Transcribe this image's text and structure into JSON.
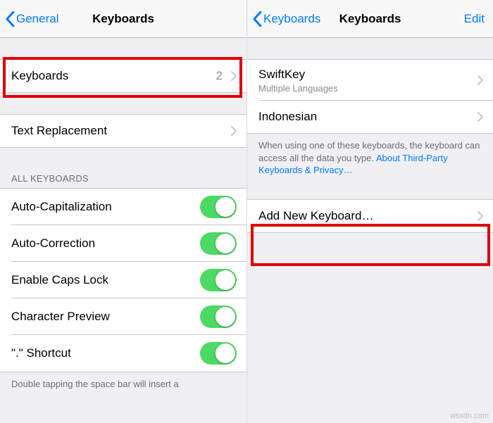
{
  "left": {
    "back": "General",
    "title": "Keyboards",
    "keyboards_row": {
      "label": "Keyboards",
      "value": "2"
    },
    "text_replacement": "Text Replacement",
    "all_header": "ALL KEYBOARDS",
    "toggles": [
      {
        "label": "Auto-Capitalization"
      },
      {
        "label": "Auto-Correction"
      },
      {
        "label": "Enable Caps Lock"
      },
      {
        "label": "Character Preview"
      },
      {
        "label": "\".\" Shortcut"
      }
    ],
    "footer": "Double tapping the space bar will insert a"
  },
  "right": {
    "back": "Keyboards",
    "title": "Keyboards",
    "edit": "Edit",
    "items": [
      {
        "label": "SwiftKey",
        "sub": "Multiple Languages"
      },
      {
        "label": "Indonesian"
      }
    ],
    "footer_pre": "When using one of these keyboards, the keyboard can access all the data you type. ",
    "footer_link": "About Third-Party Keyboards & Privacy…",
    "add_new": "Add New Keyboard…"
  },
  "watermark": "wsxdn.com"
}
